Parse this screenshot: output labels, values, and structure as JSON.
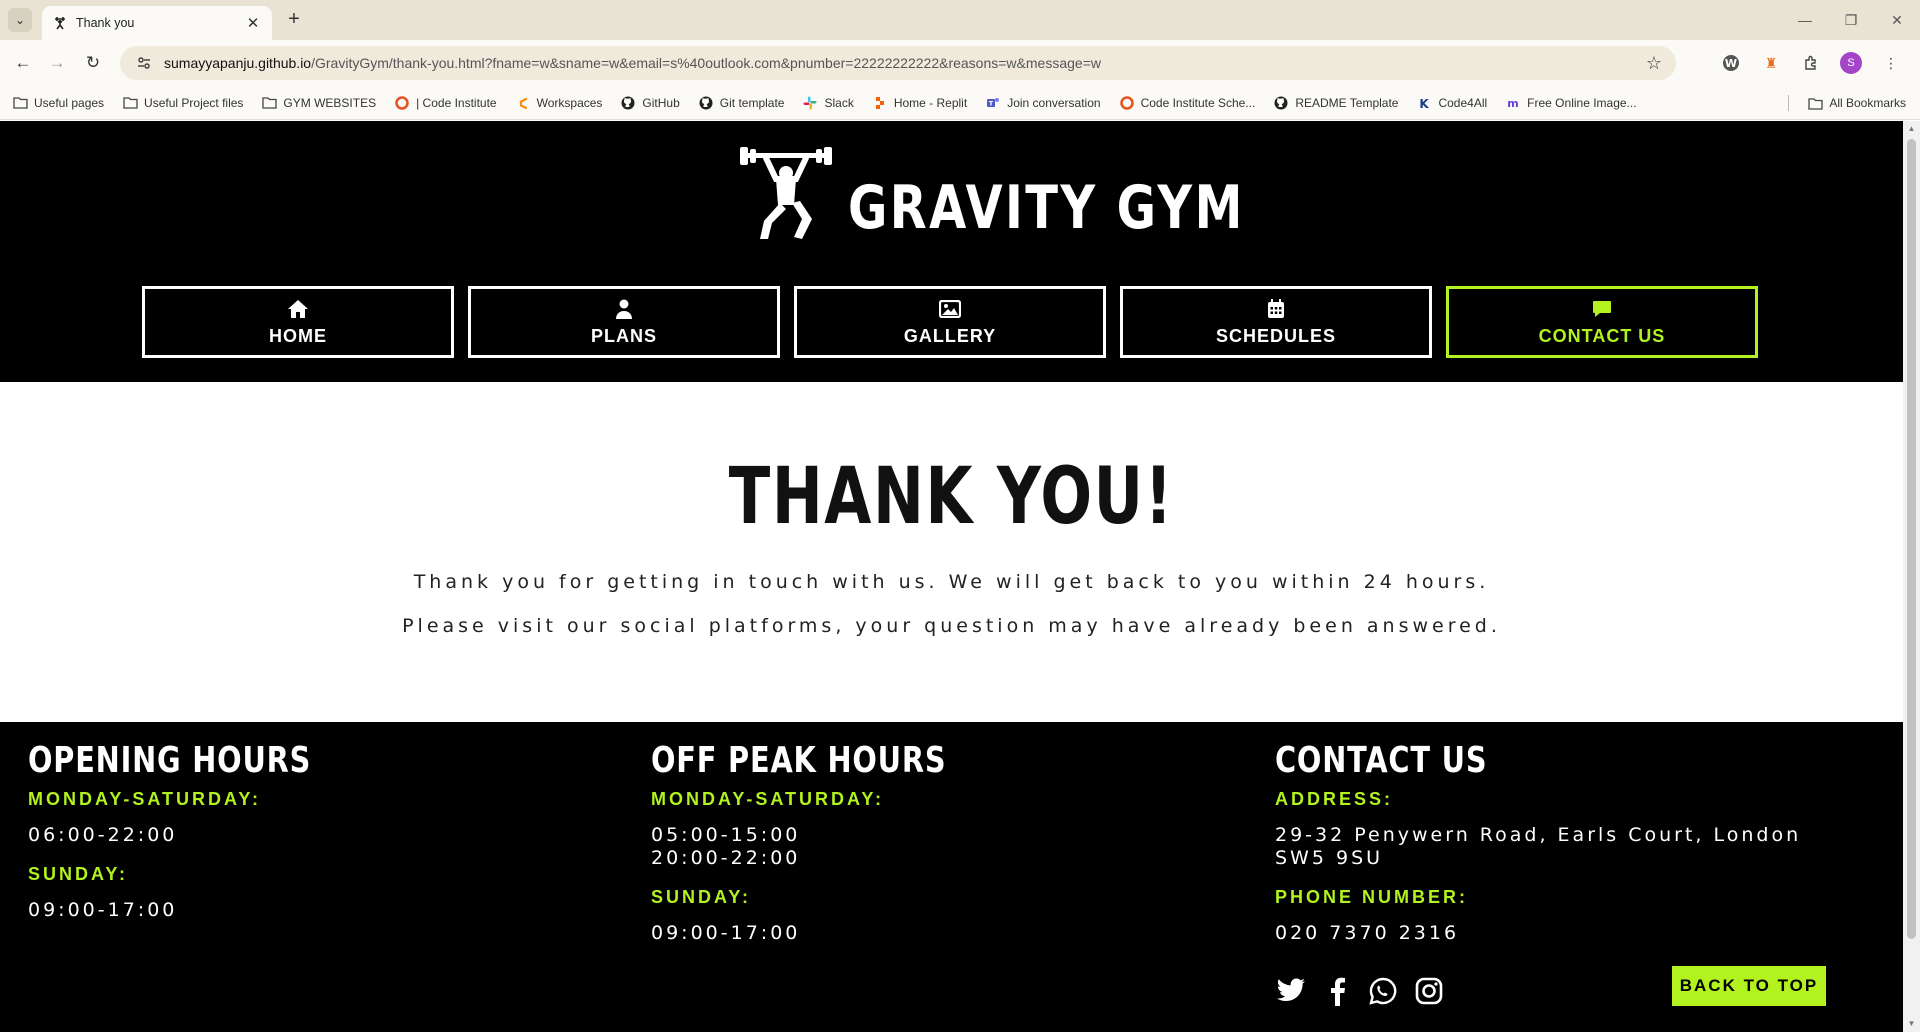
{
  "browser": {
    "tab_title": "Thank you",
    "url_host": "sumayyapanju.github.io",
    "url_path": "/GravityGym/thank-you.html?fname=w&sname=w&email=s%40outlook.com&pnumber=22222222222&reasons=w&message=w",
    "profile_initial": "S",
    "bookmarks": [
      {
        "label": "Useful pages",
        "icon": "folder-icon"
      },
      {
        "label": "Useful Project files",
        "icon": "folder-icon"
      },
      {
        "label": "GYM WEBSITES",
        "icon": "folder-icon"
      },
      {
        "label": "| Code Institute",
        "icon": "code-institute-icon"
      },
      {
        "label": "Workspaces",
        "icon": "gitpod-icon"
      },
      {
        "label": "GitHub",
        "icon": "github-icon"
      },
      {
        "label": "Git template",
        "icon": "github-icon"
      },
      {
        "label": "Slack",
        "icon": "slack-icon"
      },
      {
        "label": "Home - Replit",
        "icon": "replit-icon"
      },
      {
        "label": "Join conversation",
        "icon": "teams-icon"
      },
      {
        "label": "Code Institute Sche...",
        "icon": "code-institute-icon"
      },
      {
        "label": "README Template",
        "icon": "github-icon"
      },
      {
        "label": "Code4All",
        "icon": "code4all-icon"
      },
      {
        "label": "Free Online Image...",
        "icon": "image-tool-icon"
      }
    ],
    "all_bookmarks_label": "All Bookmarks"
  },
  "site": {
    "logo_text": "GRAVITY GYM",
    "nav": [
      {
        "label": "HOME",
        "icon": "home-icon",
        "active": false
      },
      {
        "label": "PLANS",
        "icon": "user-icon",
        "active": false
      },
      {
        "label": "GALLERY",
        "icon": "image-icon",
        "active": false
      },
      {
        "label": "SCHEDULES",
        "icon": "calendar-icon",
        "active": false
      },
      {
        "label": "CONTACT US",
        "icon": "comment-icon",
        "active": true
      }
    ],
    "accent_color": "#b2f21f"
  },
  "main": {
    "title": "THANK YOU!",
    "line1": "Thank you for getting in touch with us. We will get back to you within 24 hours.",
    "line2": "Please visit our social platforms, your question may have already been answered."
  },
  "footer": {
    "opening": {
      "heading": "OPENING HOURS",
      "weekday_label": "MONDAY-SATURDAY:",
      "weekday_hours": "06:00-22:00",
      "sunday_label": "SUNDAY:",
      "sunday_hours": "09:00-17:00"
    },
    "offpeak": {
      "heading": "OFF PEAK HOURS",
      "weekday_label": "MONDAY-SATURDAY:",
      "weekday_hours_1": "05:00-15:00",
      "weekday_hours_2": "20:00-22:00",
      "sunday_label": "SUNDAY:",
      "sunday_hours": "09:00-17:00"
    },
    "contact": {
      "heading": "CONTACT US",
      "address_label": "ADDRESS:",
      "address": "29-32 Penywern Road, Earls Court, London SW5 9SU",
      "phone_label": "PHONE NUMBER:",
      "phone": "020 7370 2316",
      "socials": [
        "twitter-icon",
        "facebook-icon",
        "whatsapp-icon",
        "instagram-icon"
      ]
    },
    "back_to_top": "BACK TO TOP"
  }
}
